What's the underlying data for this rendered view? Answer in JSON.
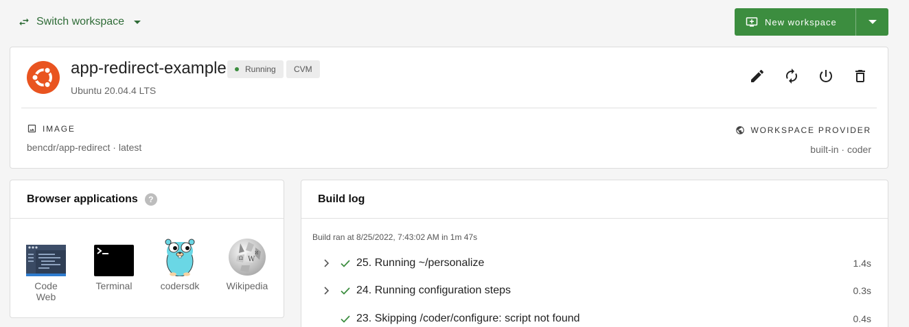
{
  "topbar": {
    "switch_label": "Switch workspace",
    "new_label": "New workspace"
  },
  "workspace": {
    "name": "app-redirect-example",
    "status": "Running",
    "tag": "CVM",
    "os": "Ubuntu 20.04.4 LTS",
    "image_label": "IMAGE",
    "image_value": "bencdr/app-redirect · latest",
    "provider_label": "WORKSPACE PROVIDER",
    "provider_value": "built-in · coder",
    "logo_icon": "ubuntu-logo",
    "colors": {
      "accent": "#3c8d3f",
      "ubuntu": "#e95420"
    }
  },
  "apps": {
    "title": "Browser applications",
    "items": [
      {
        "label": "Code Web",
        "icon": "code-web-icon"
      },
      {
        "label": "Terminal",
        "icon": "terminal-icon"
      },
      {
        "label": "codersdk",
        "icon": "gopher-icon"
      },
      {
        "label": "Wikipedia",
        "icon": "wikipedia-icon"
      }
    ]
  },
  "build_log": {
    "title": "Build log",
    "meta": "Build ran at 8/25/2022, 7:43:02 AM in 1m 47s",
    "steps": [
      {
        "text": "25. Running ~/personalize",
        "duration": "1.4s",
        "expandable": true
      },
      {
        "text": "24. Running configuration steps",
        "duration": "0.3s",
        "expandable": true
      },
      {
        "text": "23. Skipping /coder/configure: script not found",
        "duration": "0.4s",
        "expandable": false
      }
    ]
  }
}
